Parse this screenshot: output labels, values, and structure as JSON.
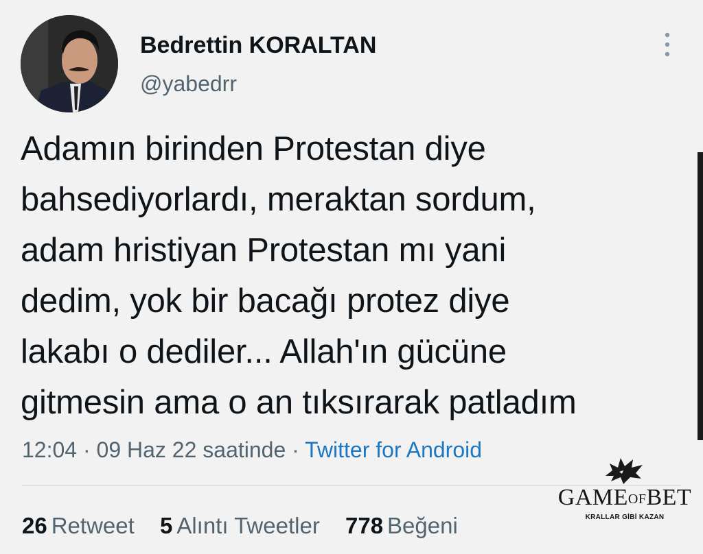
{
  "author": {
    "display_name": "Bedrettin KORALTAN",
    "handle": "@yabedrr"
  },
  "tweet": {
    "lines": [
      "Adamın birinden Protestan diye",
      "bahsediyorlardı, meraktan sordum,",
      "adam hristiyan Protestan mı yani",
      "dedim, yok bir bacağı protez diye",
      "lakabı o dediler... Allah'ın gücüne",
      "gitmesin ama o an tıksırarak patladım"
    ]
  },
  "meta": {
    "time": "12:04",
    "separator": "·",
    "date": "09 Haz 22 saatinde",
    "source": "Twitter for Android"
  },
  "stats": {
    "retweets": {
      "count": "26",
      "label": "Retweet"
    },
    "quotes": {
      "count": "5",
      "label": "Alıntı Tweetler"
    },
    "likes": {
      "count": "778",
      "label": "Beğeni"
    }
  },
  "watermark": {
    "title_left": "GAME",
    "title_mid": "OF",
    "title_right": "BET",
    "subtitle": "KRALLAR GİBİ KAZAN",
    "icon": "wolf-head-icon"
  },
  "icons": {
    "more": "more-vertical-icon"
  },
  "colors": {
    "background": "#f2f2f2",
    "text": "#0f1419",
    "secondary": "#536471",
    "link": "#1d77c2"
  }
}
